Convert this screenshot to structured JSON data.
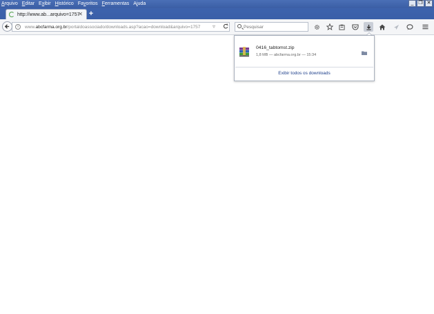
{
  "menu": [
    "Arquivo",
    "Editar",
    "Exibir",
    "Histórico",
    "Favoritos",
    "Ferramentas",
    "Ajuda"
  ],
  "menu_accel": [
    "A",
    "E",
    "x",
    "H",
    "v",
    "F",
    "j"
  ],
  "window_controls": {
    "minimize": "_",
    "restore": "❐",
    "close": "✕"
  },
  "tab": {
    "title": "http://www.ab...arquivo=1757",
    "close": "✕"
  },
  "newtab": "+",
  "urlbar": {
    "prefix": "www.",
    "domain": "abcfarma.org.br",
    "path": "/portaldoassociado/downloads.asp?acao=download&arquivo=1757",
    "dropdown": "▿"
  },
  "search": {
    "placeholder": "Pesquisar"
  },
  "toolbar_icons": [
    "gear-icon",
    "star-icon",
    "library-icon",
    "pocket-icon",
    "download-icon",
    "home-icon",
    "send-icon",
    "chat-icon",
    "menu-icon"
  ],
  "downloads": {
    "filename": "0416_tabtomst.zip",
    "status": "1,8 MB — abcfarma.org.br — 15:34",
    "show_all": "Exibir todos os downloads"
  },
  "colors": {
    "titlebar": "#3b5ea5",
    "link": "#1c3e8a",
    "panel_border": "#a9b0bd"
  }
}
